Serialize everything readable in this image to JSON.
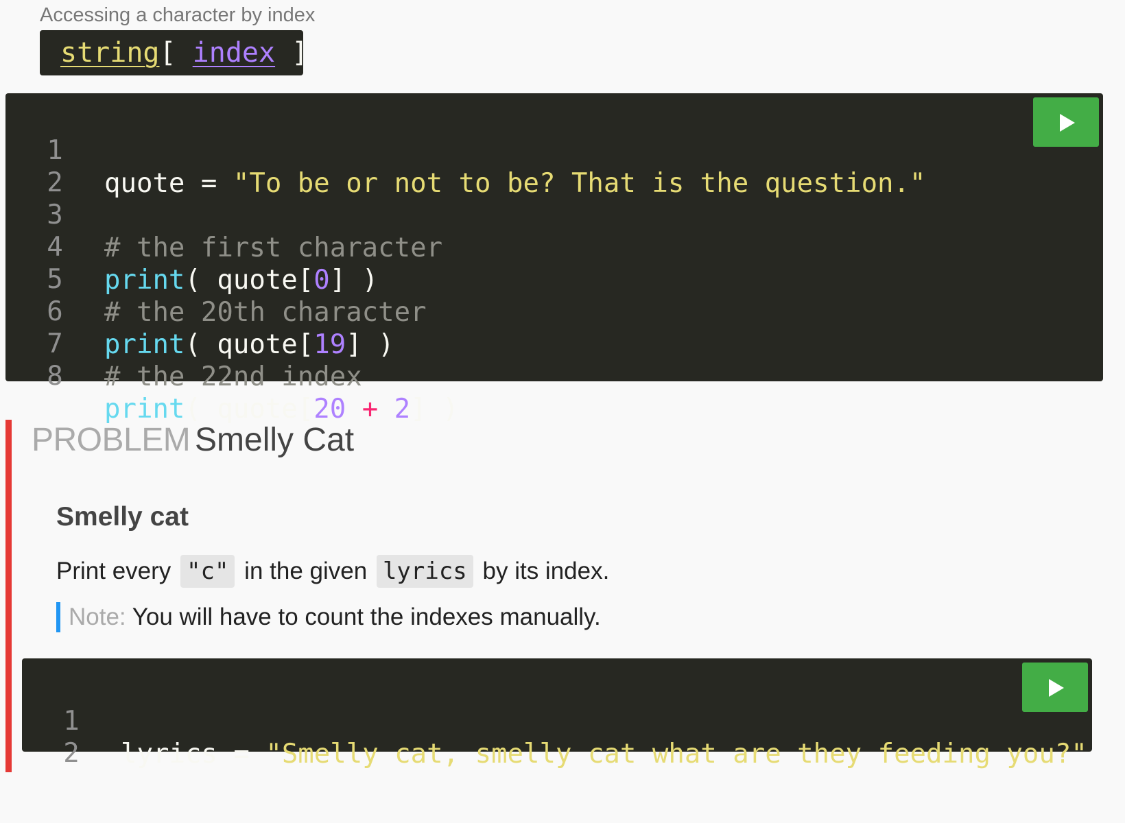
{
  "syntax": {
    "caption": "Accessing a character by index",
    "code_string": "string",
    "code_open": "[ ",
    "code_index": "index",
    "code_close": " ]"
  },
  "editor1": {
    "lines": [
      {
        "n": "1"
      },
      {
        "n": "2"
      },
      {
        "n": "3"
      },
      {
        "n": "4"
      },
      {
        "n": "5"
      },
      {
        "n": "6"
      },
      {
        "n": "7"
      },
      {
        "n": "8"
      }
    ],
    "code": {
      "l1_var": "quote",
      "l1_eq": " = ",
      "l1_str": "\"To be or not to be? That is the question.\"",
      "l3_cmt": "# the first character",
      "l4_fn": "print",
      "l4_a": "( quote[",
      "l4_num": "0",
      "l4_b": "] )",
      "l5_cmt": "# the 20th character",
      "l6_fn": "print",
      "l6_a": "( quote[",
      "l6_num": "19",
      "l6_b": "] )",
      "l7_cmt": "# the 22nd index",
      "l8_fn": "print",
      "l8_a": "( quote[",
      "l8_num1": "20",
      "l8_op": " + ",
      "l8_num2": "2",
      "l8_b": "] )"
    }
  },
  "problem": {
    "label": "PROBLEM",
    "title": "Smelly Cat",
    "heading": "Smelly cat",
    "text_1": "Print every",
    "code_1": "\"c\"",
    "text_2": "in the given",
    "code_2": "lyrics",
    "text_3": "by its index.",
    "note_label": "Note:",
    "note_text": " You will have to count the indexes manually."
  },
  "editor2": {
    "lines": [
      {
        "n": "1"
      },
      {
        "n": "2"
      }
    ],
    "code": {
      "l1_var": "lyrics",
      "l1_eq": " = ",
      "l1_str": "\"Smelly cat, smelly cat what are they feeding you?\""
    }
  },
  "colors": {
    "editor_bg": "#272822",
    "run_button": "#43ad46",
    "problem_accent": "#e53935",
    "note_accent": "#2196f3"
  },
  "icons": {
    "run": "play-icon"
  }
}
